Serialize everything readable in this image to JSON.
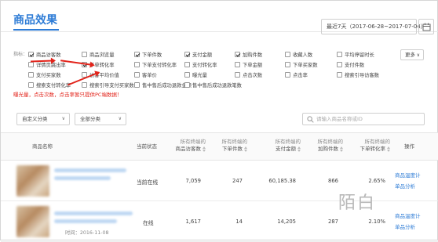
{
  "header": {
    "title": "商品效果",
    "date_range": "最近7天（2017-06-28~2017-07-04）"
  },
  "metrics": {
    "label": "指标：",
    "items": [
      {
        "label": "商品访客数",
        "checked": true
      },
      {
        "label": "商品浏览量",
        "checked": false
      },
      {
        "label": "下单件数",
        "checked": true
      },
      {
        "label": "支付金额",
        "checked": true
      },
      {
        "label": "加购件数",
        "checked": true
      },
      {
        "label": "收藏人数",
        "checked": false
      },
      {
        "label": "平均停留时长",
        "checked": false
      },
      {
        "label": "详情页跳出率",
        "checked": false
      },
      {
        "label": "下单转化率",
        "checked": true
      },
      {
        "label": "下单支付转化率",
        "checked": false
      },
      {
        "label": "支付转化率",
        "checked": false
      },
      {
        "label": "下单金额",
        "checked": false
      },
      {
        "label": "下单买家数",
        "checked": false
      },
      {
        "label": "支付件数",
        "checked": false
      },
      {
        "label": "支付买家数",
        "checked": false
      },
      {
        "label": "访客平均价值",
        "checked": false
      },
      {
        "label": "客单价",
        "checked": false
      },
      {
        "label": "曝光量",
        "checked": false
      },
      {
        "label": "点击次数",
        "checked": false
      },
      {
        "label": "点击率",
        "checked": false
      },
      {
        "label": "搜索引导访客数",
        "checked": false
      },
      {
        "label": "搜索支付转化率",
        "checked": false
      },
      {
        "label": "搜索引导支付买家数",
        "checked": false
      },
      {
        "label": "售中售后成功退款金额",
        "checked": false
      },
      {
        "label": "售中售后成功退款笔数",
        "checked": false
      }
    ],
    "more_label": "更多",
    "warning": "曝光量，点击次数，点击率暂只提供PC端数据！"
  },
  "filters": {
    "custom_category": "自定义分类",
    "all_category": "全部分类",
    "search_placeholder": "请输入商品名称或ID"
  },
  "table": {
    "headers": {
      "name": "商品名称",
      "status": "当前状态",
      "c1_top": "所有终端的",
      "c1_bottom": "商品访客数",
      "c2_top": "所有终端的",
      "c2_bottom": "下单件数",
      "c3_top": "所有终端的",
      "c3_bottom": "支付金额",
      "c4_top": "所有终端的",
      "c4_bottom": "加购件数",
      "c5_top": "所有终端的",
      "c5_bottom": "下单转化率",
      "op": "操作"
    },
    "rows": [
      {
        "status": "当前在线",
        "visitors": "7,059",
        "order_qty": "247",
        "pay_amount": "60,185.38",
        "cart_qty": "866",
        "conv_rate": "2.65%",
        "op1": "商品温度计",
        "op2": "单品分析"
      },
      {
        "status": "在线",
        "visitors": "1,617",
        "order_qty": "14",
        "pay_amount": "14,205",
        "cart_qty": "287",
        "conv_rate": "2.10%",
        "op1": "商品温度计",
        "op2": "单品分析",
        "published": "时间：2016-11-08"
      }
    ]
  },
  "watermark": "陌白"
}
